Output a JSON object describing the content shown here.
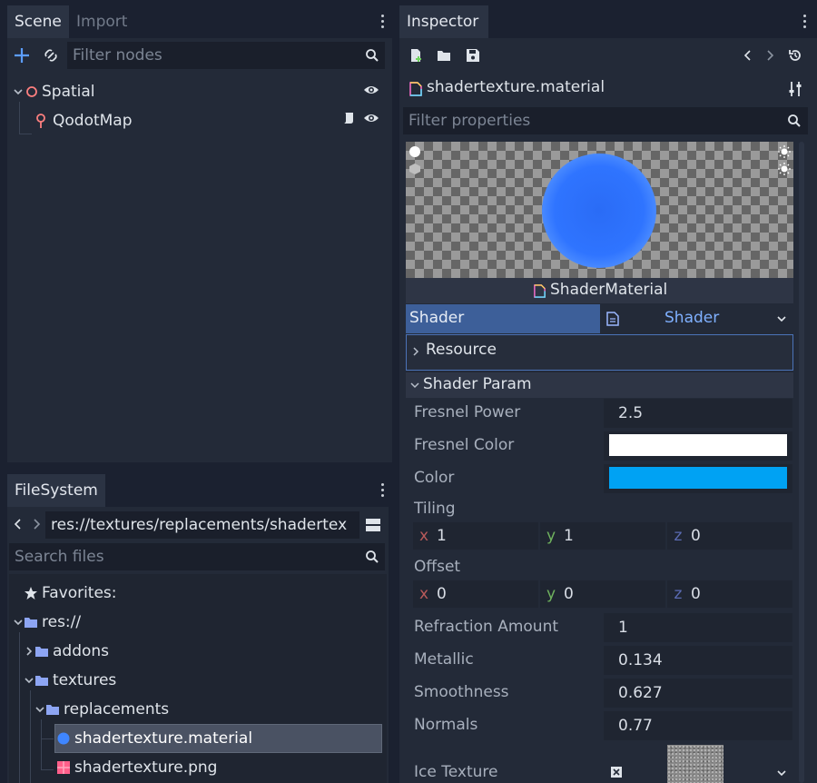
{
  "scene_dock": {
    "tabs": [
      {
        "label": "Scene"
      },
      {
        "label": "Import"
      }
    ],
    "filter_placeholder": "Filter nodes",
    "nodes": [
      {
        "label": "Spatial"
      },
      {
        "label": "QodotMap"
      }
    ]
  },
  "filesystem_dock": {
    "tab_label": "FileSystem",
    "path": "res://textures/replacements/shadertex",
    "search_placeholder": "Search files",
    "tree": {
      "favorites": "Favorites:",
      "root": "res://",
      "addons": "addons",
      "textures": "textures",
      "replacements": "replacements",
      "material_file": "shadertexture.material",
      "png_file": "shadertexture.png"
    }
  },
  "inspector": {
    "tab_label": "Inspector",
    "resource_name": "shadertexture.material",
    "filter_placeholder": "Filter properties",
    "preview_caption": "ShaderMaterial",
    "shader_label": "Shader",
    "shader_value": "Shader",
    "resource_section": "Resource",
    "shader_param_section": "Shader Param",
    "props": {
      "fresnel_power_label": "Fresnel Power",
      "fresnel_power_value": "2.5",
      "fresnel_color_label": "Fresnel Color",
      "fresnel_color_value": "#ffffff",
      "color_label": "Color",
      "color_value": "#00a2f3",
      "tiling_label": "Tiling",
      "tiling_x": "1",
      "tiling_y": "1",
      "tiling_z": "0",
      "offset_label": "Offset",
      "offset_x": "0",
      "offset_y": "0",
      "offset_z": "0",
      "refraction_label": "Refraction Amount",
      "refraction_value": "1",
      "metallic_label": "Metallic",
      "metallic_value": "0.134",
      "smoothness_label": "Smoothness",
      "smoothness_value": "0.627",
      "normals_label": "Normals",
      "normals_value": "0.77",
      "ice_texture_label": "Ice Texture"
    },
    "axis_labels": {
      "x": "x",
      "y": "y",
      "z": "z"
    }
  },
  "colors": {
    "accent": "#3f7bd1",
    "axis_x": "#b85a5a",
    "axis_y": "#6fb25e",
    "axis_z": "#5b6bb3",
    "node_spatial": "#fc7f7f",
    "folder": "#8da5f3"
  }
}
